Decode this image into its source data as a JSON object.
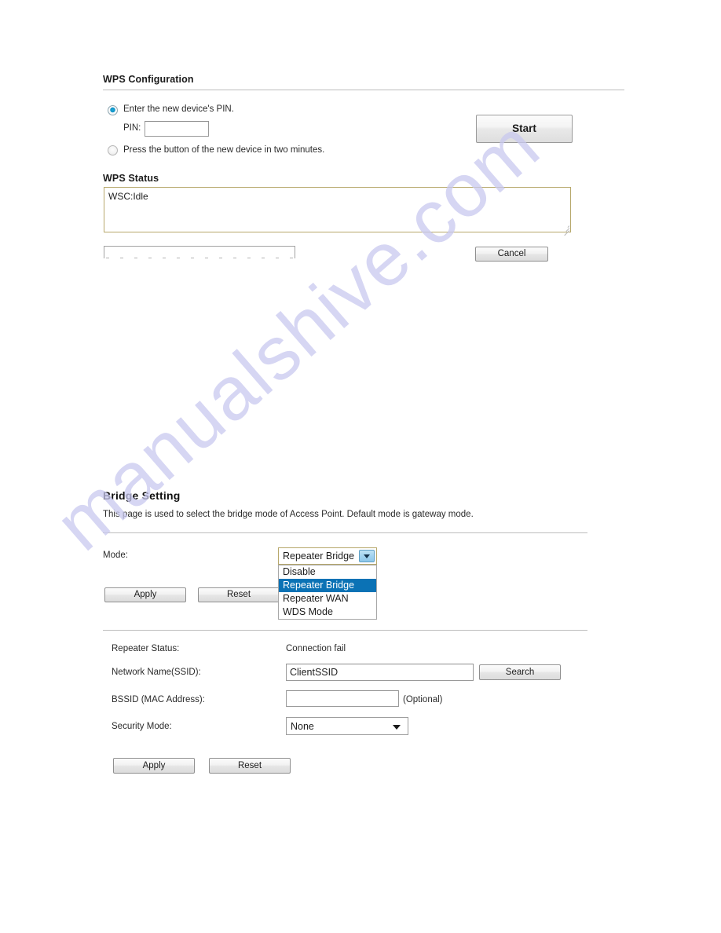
{
  "wps": {
    "section_title": "WPS Configuration",
    "option_pin_label": "Enter the new device's PIN.",
    "pin_label": "PIN:",
    "pin_value": "",
    "pin_placeholder": "",
    "option_button_label": "Press the button of the new device in two minutes.",
    "start_button": "Start",
    "status_title": "WPS Status",
    "status_text": "WSC:Idle",
    "cancel_button": "Cancel",
    "clipped_field_value": ""
  },
  "bridge": {
    "section_title": "Bridge Setting",
    "description": "This page is used to select the bridge mode of Access Point. Default mode is gateway mode.",
    "mode_label": "Mode:",
    "mode_selected": "Repeater Bridge",
    "mode_options": [
      "Disable",
      "Repeater Bridge",
      "Repeater WAN",
      "WDS Mode"
    ],
    "apply_button": "Apply",
    "reset_button": "Reset",
    "repeater_status_label": "Repeater Status:",
    "repeater_status_value": "Connection fail",
    "ssid_label": "Network Name(SSID):",
    "ssid_value": "ClientSSID",
    "search_button": "Search",
    "bssid_label": "BSSID (MAC Address):",
    "bssid_value": "",
    "bssid_hint": "(Optional)",
    "security_label": "Security Mode:",
    "security_value": "None",
    "apply_button_bottom": "Apply",
    "reset_button_bottom": "Reset"
  },
  "watermark": {
    "text": "manualshive.com"
  },
  "colors": {
    "highlight": "#0b72b5",
    "field_border_accent": "#b7a86b",
    "radio_on": "#1090c4",
    "watermark": "#c9c9ef"
  }
}
